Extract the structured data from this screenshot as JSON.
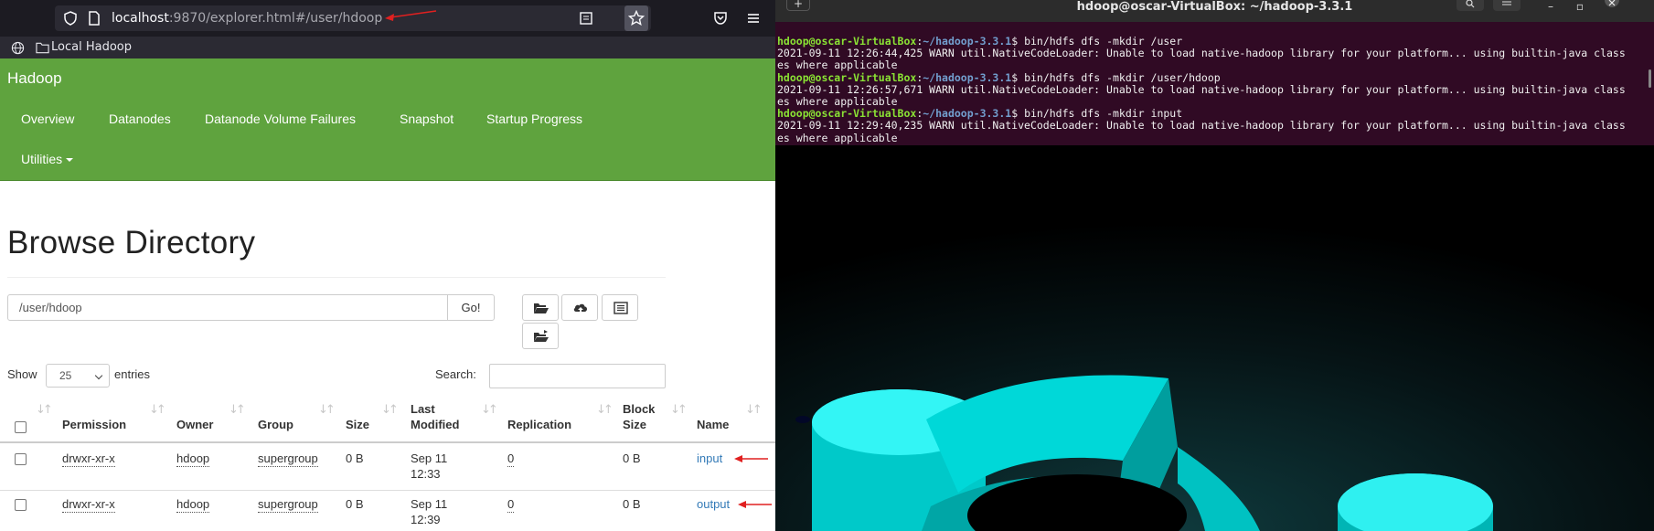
{
  "browser": {
    "url_host": "localhost",
    "url_path": ":9870/explorer.html#/user/hdoop",
    "bookmark_label": "Local Hadoop"
  },
  "nav": {
    "brand": "Hadoop",
    "links": [
      "Overview",
      "Datanodes",
      "Datanode Volume Failures",
      "Snapshot",
      "Startup Progress"
    ],
    "utilities": "Utilities"
  },
  "page": {
    "title": "Browse Directory",
    "directory_value": "/user/hdoop",
    "go_label": "Go!",
    "show_label": "Show",
    "show_value": "25",
    "entries_label": "entries",
    "search_label": "Search:"
  },
  "table": {
    "headers": [
      [
        "",
        ""
      ],
      [
        "",
        "Permission"
      ],
      [
        "",
        "Owner"
      ],
      [
        "",
        "Group"
      ],
      [
        "",
        "Size"
      ],
      [
        "Last",
        "Modified"
      ],
      [
        "",
        "Replication"
      ],
      [
        "Block",
        "Size"
      ],
      [
        "",
        "Name"
      ]
    ],
    "rows": [
      {
        "permission": "drwxr-xr-x",
        "owner": "hdoop",
        "group": "supergroup",
        "size": "0 B",
        "modified_date": "Sep 11",
        "modified_time": "12:33",
        "replication": "0",
        "block_size": "0 B",
        "name": "input"
      },
      {
        "permission": "drwxr-xr-x",
        "owner": "hdoop",
        "group": "supergroup",
        "size": "0 B",
        "modified_date": "Sep 11",
        "modified_time": "12:39",
        "replication": "0",
        "block_size": "0 B",
        "name": "output"
      }
    ]
  },
  "terminal": {
    "title": "hdoop@oscar-VirtualBox: ~/hadoop-3.3.1",
    "prompt_user": "hdoop@oscar-VirtualBox",
    "prompt_sep": ":",
    "prompt_path": "~/hadoop-3.3.1",
    "prompt_end": "$ ",
    "commands": [
      {
        "cmd": "bin/hdfs dfs -mkdir /user",
        "out1": "2021-09-11 12:26:44,425 WARN util.NativeCodeLoader: Unable to load native-hadoop library for your platform... using builtin-java class",
        "out2": "es where applicable"
      },
      {
        "cmd": "bin/hdfs dfs -mkdir /user/hdoop",
        "out1": "2021-09-11 12:26:57,671 WARN util.NativeCodeLoader: Unable to load native-hadoop library for your platform... using builtin-java class",
        "out2": "es where applicable"
      },
      {
        "cmd": "bin/hdfs dfs -mkdir input",
        "out1": "2021-09-11 12:29:40,235 WARN util.NativeCodeLoader: Unable to load native-hadoop library for your platform... using builtin-java class",
        "out2": "es where applicable"
      }
    ]
  },
  "colors": {
    "navbar": "#5fa33e",
    "link": "#337ab7",
    "terminal_bg": "#300a24",
    "annotation_arrow": "#e02020"
  },
  "icons": [
    "shield-icon",
    "page-icon",
    "reader-icon",
    "star-icon",
    "pocket-icon",
    "menu-icon",
    "globe-icon",
    "folder-icon",
    "open-folder-icon",
    "upload-icon",
    "list-icon",
    "folder-move-icon",
    "sort-icon",
    "new-tab-icon",
    "search-icon",
    "minimize-icon",
    "maximize-icon",
    "close-icon"
  ]
}
